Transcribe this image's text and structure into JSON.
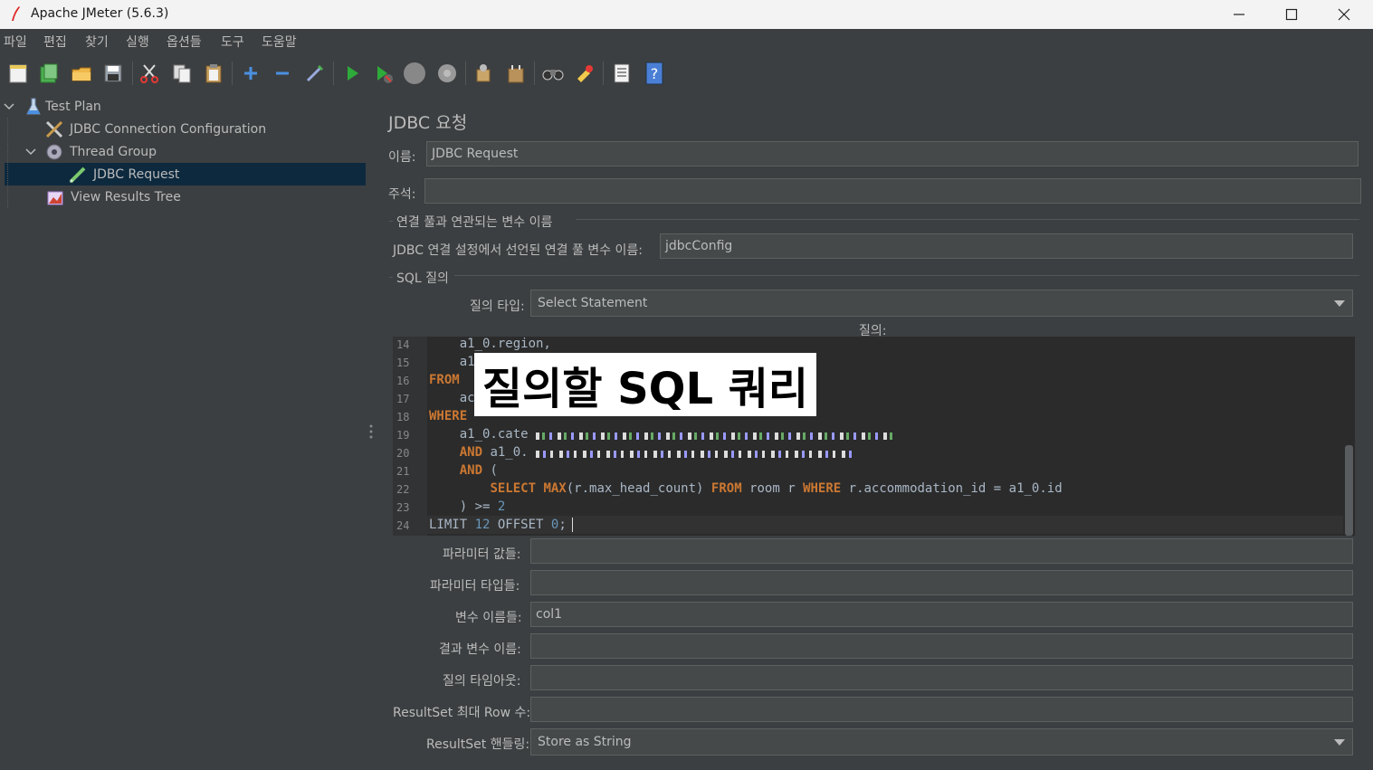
{
  "window": {
    "title": "Apache JMeter (5.6.3)"
  },
  "menu": [
    "파일",
    "편집",
    "찾기",
    "실행",
    "옵션들",
    "도구",
    "도움말"
  ],
  "tree": {
    "items": [
      {
        "label": "Test Plan",
        "icon": "flask-icon"
      },
      {
        "label": "JDBC Connection Configuration",
        "icon": "tools-icon"
      },
      {
        "label": "Thread Group",
        "icon": "gear-icon"
      },
      {
        "label": "JDBC Request",
        "icon": "pen-icon"
      },
      {
        "label": "View Results Tree",
        "icon": "chart-icon"
      }
    ]
  },
  "panel": {
    "heading": "JDBC 요청",
    "name_label": "이름:",
    "name_value": "JDBC Request",
    "comment_label": "주석:",
    "comment_value": "",
    "pool_section": "연결 풀과 연관되는 변수 이름",
    "pool_var_label": "JDBC 연결 설정에서 선언된 연결 풀 변수 이름:",
    "pool_var_value": "jdbcConfig",
    "sql_section": "SQL 질의",
    "query_type_label": "질의 타입:",
    "query_type_value": "Select Statement",
    "query_label": "질의:",
    "overlay_text": "질의할 SQL 쿼리",
    "params_values_label": "파라미터 값들:",
    "params_values": "",
    "params_types_label": "파라미터 타입들:",
    "params_types": "",
    "var_names_label": "변수 이름들:",
    "var_names": "col1",
    "result_var_label": "결과 변수 이름:",
    "result_var": "",
    "timeout_label": "질의 타임아웃:",
    "timeout": "",
    "max_rows_label": "ResultSet 최대 Row 수:",
    "max_rows": "",
    "handling_label": "ResultSet 핸들링:",
    "handling_value": "Store as String"
  },
  "code": {
    "line_numbers": [
      "14",
      "15",
      "16",
      "17",
      "18",
      "19",
      "20",
      "21",
      "22",
      "23",
      "24"
    ],
    "lines": {
      "l14": "    a1_0.region,",
      "l15": "    a1",
      "l16_kw": "FROM",
      "l17": "    ac",
      "l18_kw": "WHERE",
      "l19": "    a1_0.cate",
      "l20_kw": "AND",
      "l20_rest": " a1_0.",
      "l21_kw": "AND",
      "l21_rest": " (",
      "l22_select": "SELECT",
      "l22_max": "MAX",
      "l22_a": "(r.max_head_count) ",
      "l22_from": "FROM",
      "l22_b": " room r ",
      "l22_where": "WHERE",
      "l22_c": " r.accommodation_id = a1_0.id",
      "l23_a": "    ) >= ",
      "l23_num": "2",
      "l24_a": "LIMIT ",
      "l24_n1": "12",
      "l24_b": " OFFSET ",
      "l24_n2": "0",
      "l24_c": ";"
    }
  },
  "colors": {
    "background": "#3c3f41",
    "keyword": "#cc7832",
    "number": "#6897bb",
    "selection": "#0d293e"
  }
}
